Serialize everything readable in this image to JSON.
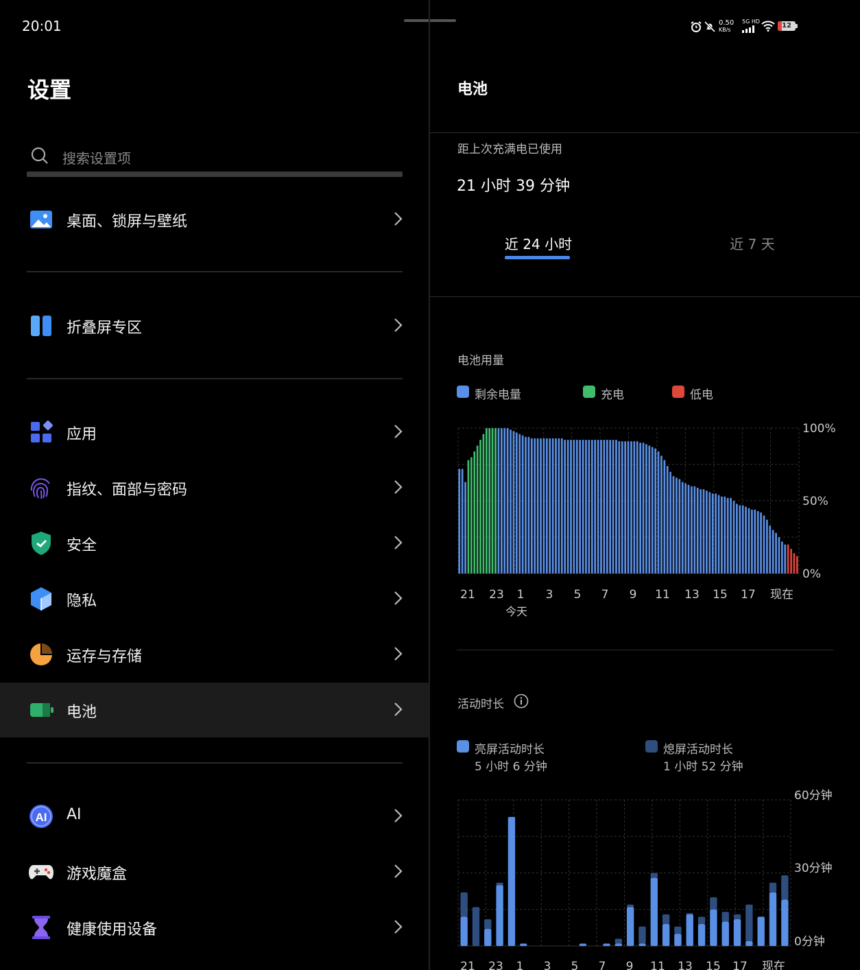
{
  "status_bar": {
    "time": "20:01",
    "net_speed": "0.50",
    "net_unit": "KB/s",
    "net_type": "5G HD",
    "battery": "12"
  },
  "left": {
    "title": "设置",
    "search": {
      "placeholder": "搜索设置项"
    },
    "items": [
      {
        "label": "桌面、锁屏与壁纸",
        "icon": "wallpaper-icon"
      },
      {
        "label": "折叠屏专区",
        "icon": "foldable-icon"
      },
      {
        "label": "应用",
        "icon": "apps-icon"
      },
      {
        "label": "指纹、面部与密码",
        "icon": "fingerprint-icon"
      },
      {
        "label": "安全",
        "icon": "shield-icon"
      },
      {
        "label": "隐私",
        "icon": "privacy-icon"
      },
      {
        "label": "运存与存储",
        "icon": "storage-pie-icon"
      },
      {
        "label": "电池",
        "icon": "battery-icon"
      },
      {
        "label": "AI",
        "icon": "ai-icon"
      },
      {
        "label": "游戏魔盒",
        "icon": "gamepad-icon"
      },
      {
        "label": "健康使用设备",
        "icon": "hourglass-icon"
      }
    ]
  },
  "right": {
    "title": "电池",
    "since_full_label": "距上次充满电已使用",
    "since_full_value": "21 小时 39 分钟",
    "tabs": [
      {
        "label": "近 24 小时",
        "active": true
      },
      {
        "label": "近 7 天",
        "active": false
      }
    ],
    "usage_title": "电池用量",
    "usage_legend": [
      "剩余电量",
      "充电",
      "低电"
    ],
    "activity_title": "活动时长",
    "activity_legend": [
      {
        "label": "亮屏活动时长",
        "value": "5 小时 6 分钟"
      },
      {
        "label": "熄屏活动时长",
        "value": "1 小时 52 分钟"
      }
    ],
    "colors": {
      "remaining": "#5a8fe6",
      "charging": "#3ebd6b",
      "low": "#e0463c",
      "screen_on": "#5a8fe6",
      "screen_off": "#2f4e80",
      "accent": "#4a88e8"
    }
  },
  "chart_data": [
    {
      "type": "bar",
      "title": "电池用量",
      "ylim": [
        0,
        100
      ],
      "y_ticks": [
        "100%",
        "50%",
        "0%"
      ],
      "x_ticks": [
        "21",
        "23",
        "1",
        "3",
        "5",
        "7",
        "9",
        "11",
        "13",
        "15",
        "17",
        "现在"
      ],
      "x_sublabel": "今天",
      "series": [
        {
          "name": "剩余电量",
          "values": [
            72,
            72,
            63,
            0,
            0,
            0,
            0,
            0,
            0,
            100,
            100,
            100,
            100,
            100,
            100,
            100,
            100,
            99,
            98,
            97,
            96,
            95,
            94,
            94,
            93,
            93,
            93,
            93,
            93,
            93,
            93,
            93,
            93,
            93,
            93,
            92,
            92,
            92,
            92,
            92,
            92,
            92,
            92,
            92,
            92,
            92,
            92,
            92,
            92,
            92,
            92,
            92,
            92,
            91,
            91,
            91,
            91,
            91,
            91,
            91,
            90,
            90,
            89,
            88,
            87,
            86,
            84,
            81,
            78,
            74,
            70,
            67,
            66,
            65,
            63,
            62,
            61,
            60,
            60,
            59,
            58,
            58,
            57,
            56,
            55,
            55,
            54,
            53,
            53,
            52,
            52,
            50,
            48,
            47,
            47,
            46,
            45,
            44,
            44,
            43,
            42,
            40,
            37,
            33,
            30,
            28,
            25,
            22,
            20,
            0,
            0,
            0,
            0
          ]
        },
        {
          "name": "充电",
          "values": [
            0,
            0,
            0,
            78,
            80,
            84,
            88,
            92,
            96,
            100,
            100,
            100,
            100,
            0,
            0,
            0,
            0,
            0,
            0,
            0,
            0,
            0,
            0,
            0,
            0,
            0,
            0,
            0,
            0,
            0,
            0,
            0,
            0,
            0,
            0,
            0,
            0,
            0,
            0,
            0,
            0,
            0,
            0,
            0,
            0,
            0,
            0,
            0,
            0,
            0,
            0,
            0,
            0,
            0,
            0,
            0,
            0,
            0,
            0,
            0,
            0,
            0,
            0,
            0,
            0,
            0,
            0,
            0,
            0,
            0,
            0,
            0,
            0,
            0,
            0,
            0,
            0,
            0,
            0,
            0,
            0,
            0,
            0,
            0,
            0,
            0,
            0,
            0,
            0,
            0,
            0,
            0,
            0,
            0,
            0,
            0,
            0,
            0,
            0,
            0,
            0,
            0,
            0,
            0,
            0,
            0,
            0,
            0,
            0,
            0,
            0,
            0,
            0
          ]
        },
        {
          "name": "低电",
          "values": [
            0,
            0,
            0,
            0,
            0,
            0,
            0,
            0,
            0,
            0,
            0,
            0,
            0,
            0,
            0,
            0,
            0,
            0,
            0,
            0,
            0,
            0,
            0,
            0,
            0,
            0,
            0,
            0,
            0,
            0,
            0,
            0,
            0,
            0,
            0,
            0,
            0,
            0,
            0,
            0,
            0,
            0,
            0,
            0,
            0,
            0,
            0,
            0,
            0,
            0,
            0,
            0,
            0,
            0,
            0,
            0,
            0,
            0,
            0,
            0,
            0,
            0,
            0,
            0,
            0,
            0,
            0,
            0,
            0,
            0,
            0,
            0,
            0,
            0,
            0,
            0,
            0,
            0,
            0,
            0,
            0,
            0,
            0,
            0,
            0,
            0,
            0,
            0,
            0,
            0,
            0,
            0,
            0,
            0,
            0,
            0,
            0,
            0,
            0,
            0,
            0,
            0,
            0,
            0,
            0,
            0,
            0,
            0,
            0,
            20,
            17,
            14,
            12
          ]
        }
      ]
    },
    {
      "type": "bar",
      "title": "活动时长",
      "ylim": [
        0,
        60
      ],
      "y_ticks": [
        "60分钟",
        "30分钟",
        "0分钟"
      ],
      "x_ticks": [
        "21",
        "23",
        "1",
        "3",
        "5",
        "7",
        "9",
        "11",
        "13",
        "15",
        "17",
        "现在"
      ],
      "series": [
        {
          "name": "亮屏活动时长",
          "values": [
            12,
            0,
            7,
            25,
            53,
            1,
            0,
            0,
            0,
            0,
            1,
            0,
            1,
            1,
            16,
            1,
            28,
            9,
            5,
            13,
            9,
            15,
            10,
            11,
            2,
            12,
            22,
            19
          ]
        },
        {
          "name": "熄屏活动时长",
          "values": [
            10,
            16,
            4,
            1,
            0,
            0,
            0,
            0,
            0,
            0,
            0,
            0,
            0,
            2,
            1,
            7,
            2,
            4,
            3,
            0.5,
            3,
            5,
            4,
            2,
            15,
            0,
            4,
            10
          ]
        }
      ]
    }
  ]
}
